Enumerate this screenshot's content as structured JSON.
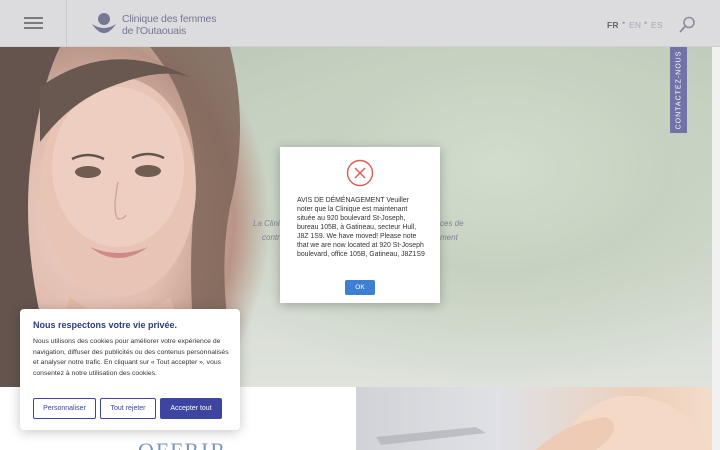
{
  "header": {
    "logo_line1": "Clinique des femmes",
    "logo_line2": "de l'Outaouais",
    "languages": [
      "FR",
      "EN",
      "ES"
    ],
    "active_language": "FR",
    "colors": {
      "header_bg": "#d3d3d5",
      "brand": "#4f5175"
    },
    "icons": {
      "menu": "hamburger-icon",
      "logo": "clinic-logo",
      "search": "search-icon"
    }
  },
  "hero": {
    "text_fragments": [
      "La Clini",
      "ces de",
      "contr",
      "ment"
    ],
    "contact_tab": "CONTACTEZ-NOUS"
  },
  "modal": {
    "icon": "close-circle-icon",
    "message": "AVIS DE DÉMÉNAGEMENT Veuiller noter que la Clinique est maintenant située au 920 boulevard St-Joseph, bureau 105B, à Gatineau, secteur Hull, J8Z 1S9. We have moved! Please note that we are now located at 920 St-Joseph boulevard, office 105B, Gatineau, J8Z1S9",
    "ok_label": "OK"
  },
  "cookie": {
    "title": "Nous respectons votre vie privée.",
    "text": "Nous utilisons des cookies pour améliorer votre expérience de navigation, diffuser des publicités ou des contenus personnalisés et analyser notre trafic. En cliquant sur « Tout accepter », vous consentez à notre utilisation des cookies.",
    "customize_label": "Personnaliser",
    "reject_label": "Tout rejeter",
    "accept_label": "Accepter tout"
  },
  "lower": {
    "heading": "OFFRIR"
  }
}
